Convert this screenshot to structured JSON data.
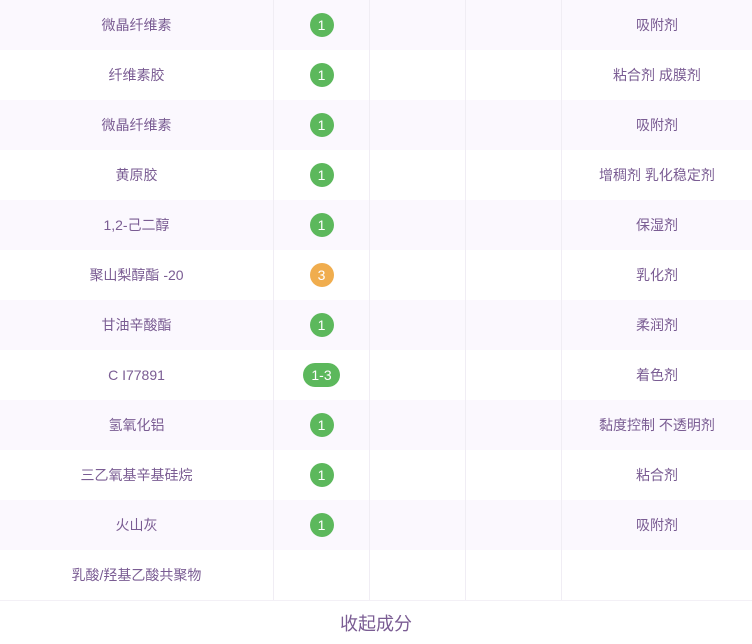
{
  "rows": [
    {
      "name": "微晶纤维素",
      "score": "1",
      "level": "green",
      "purpose": "吸附剂"
    },
    {
      "name": "纤维素胶",
      "score": "1",
      "level": "green",
      "purpose": "粘合剂 成膜剂"
    },
    {
      "name": "微晶纤维素",
      "score": "1",
      "level": "green",
      "purpose": "吸附剂"
    },
    {
      "name": "黄原胶",
      "score": "1",
      "level": "green",
      "purpose": "增稠剂 乳化稳定剂"
    },
    {
      "name": "1,2-己二醇",
      "score": "1",
      "level": "green",
      "purpose": "保湿剂"
    },
    {
      "name": "聚山梨醇酯 -20",
      "score": "3",
      "level": "orange",
      "purpose": "乳化剂"
    },
    {
      "name": "甘油辛酸酯",
      "score": "1",
      "level": "green",
      "purpose": "柔润剂"
    },
    {
      "name": "C I77891",
      "score": "1-3",
      "level": "green",
      "purpose": "着色剂"
    },
    {
      "name": "氢氧化铝",
      "score": "1",
      "level": "green",
      "purpose": "黏度控制 不透明剂"
    },
    {
      "name": "三乙氧基辛基硅烷",
      "score": "1",
      "level": "green",
      "purpose": "粘合剂"
    },
    {
      "name": "火山灰",
      "score": "1",
      "level": "green",
      "purpose": "吸附剂"
    },
    {
      "name": "乳酸/羟基乙酸共聚物",
      "score": "",
      "level": "",
      "purpose": ""
    }
  ],
  "collapse_label": "收起成分",
  "colors": {
    "green": "#5cb85c",
    "orange": "#f0ad4e",
    "text": "#7a5c93"
  }
}
